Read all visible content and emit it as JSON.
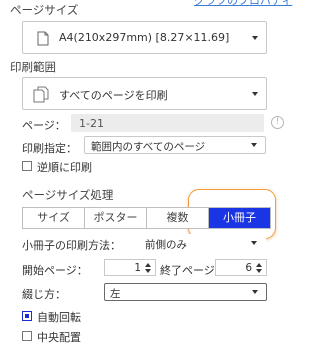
{
  "header": {
    "link_text": "グラフのプロパティ"
  },
  "page_size": {
    "title": "ページサイズ",
    "value": "A4(210x297mm) [8.27×11.69]"
  },
  "print_range": {
    "title": "印刷範囲",
    "value": "すべてのページを印刷",
    "pages_label": "ページ：",
    "pages_value": "1-21",
    "spec_label": "印刷指定：",
    "spec_value": "範囲内のすべてのページ",
    "reverse_label": "逆順に印刷"
  },
  "page_handling": {
    "title": "ページサイズ処理",
    "tabs": [
      "サイズ",
      "ポスター",
      "複数",
      "小冊子"
    ],
    "active_tab": "小冊子",
    "booklet_method_label": "小冊子の印刷方法：",
    "booklet_method_value": "前側のみ",
    "start_page_label": "開始ページ：",
    "start_page_value": "1",
    "end_page_label": "終了ページ",
    "end_page_value": "6",
    "binding_label": "綴じ方：",
    "binding_value": "左"
  },
  "options": {
    "auto_rotate_label": "自動回転",
    "auto_rotate_checked": true,
    "center_label": "中央配置",
    "center_checked": false
  },
  "colors": {
    "accent": "#1a35e6",
    "highlight": "#f2993d",
    "link": "#3b7dd8"
  }
}
